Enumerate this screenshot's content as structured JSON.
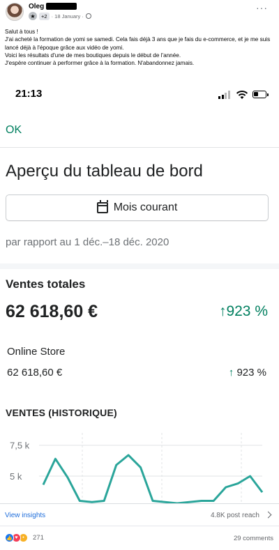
{
  "post": {
    "author": "Oleg",
    "plus_badge": "+2",
    "date": "· 18 January ·",
    "more": "···",
    "body": [
      "Salut à tous !",
      "J'ai acheté la formation de yomi se samedi. Cela fais déjà 3 ans que je fais du e-commerce, et je me suis lancé déjà à l'époque grâce aux vidéo de yomi.",
      "Voici les résultats d'une de mes boutiques depuis le début de l'année.",
      "J'espère continuer à performer grâce à la formation. N'abandonnez jamais."
    ]
  },
  "screenshot": {
    "status_time": "21:13",
    "ok_label": "OK",
    "title": "Aperçu du tableau de bord",
    "period_button": "Mois courant",
    "comparison": "par rapport au 1 déc.–18 déc. 2020",
    "total_sales": {
      "label": "Ventes totales",
      "value": "62 618,60 €",
      "delta": "923 %"
    },
    "online_store": {
      "label": "Online Store",
      "value": "62 618,60 €",
      "delta": "923 %"
    },
    "history_label": "VENTES (HISTORIQUE)"
  },
  "chart_data": {
    "type": "line",
    "ytick_labels": [
      "7,5 k",
      "5 k"
    ],
    "yticks": [
      7500,
      5000
    ],
    "ylim": [
      2800,
      8500
    ],
    "series": [
      {
        "color": "#2aa59a",
        "x": [
          0,
          1,
          2,
          3,
          4,
          5,
          6,
          7,
          8,
          9,
          10,
          11,
          12,
          13,
          14,
          15,
          16,
          17,
          18
        ],
        "values": [
          4300,
          6400,
          4900,
          3000,
          2900,
          3000,
          5900,
          6700,
          5700,
          3000,
          2900,
          2800,
          2900,
          3000,
          3000,
          4100,
          4400,
          5000,
          3700
        ]
      }
    ],
    "grid": true
  },
  "footer": {
    "insights": "View insights",
    "reach": "4.8K post reach",
    "reaction_count": "271",
    "comments": "29 comments"
  },
  "colors": {
    "accent_green": "#007f5f",
    "chart_line": "#2aa59a",
    "link_blue": "#216fdb"
  }
}
